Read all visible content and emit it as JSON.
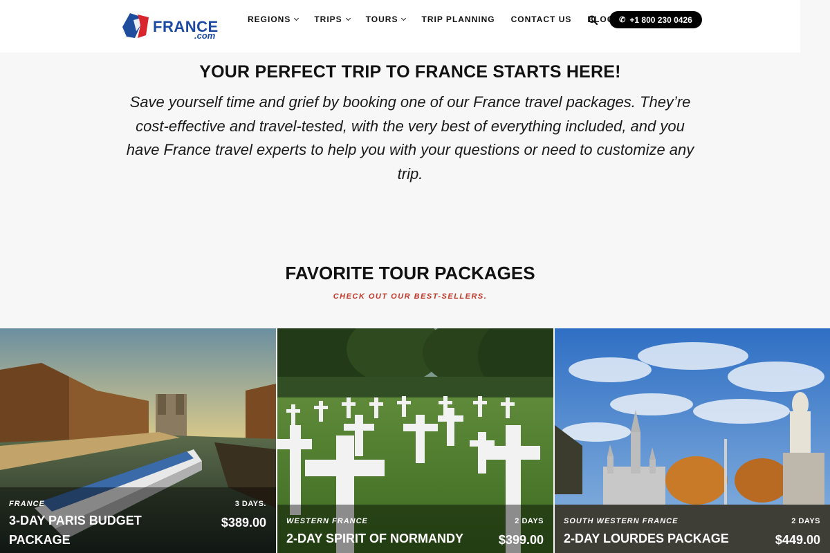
{
  "header": {
    "logo_text": "FRANCE",
    "logo_sub": ".com",
    "nav": [
      {
        "label": "REGIONS",
        "has_dropdown": true
      },
      {
        "label": "TRIPS",
        "has_dropdown": true
      },
      {
        "label": "TOURS",
        "has_dropdown": true
      },
      {
        "label": "TRIP PLANNING",
        "has_dropdown": false
      },
      {
        "label": "CONTACT US",
        "has_dropdown": false
      },
      {
        "label": "BLOG",
        "has_dropdown": false
      }
    ],
    "search_icon": "search-icon",
    "phone_label": "+1 800 230 0426"
  },
  "hero": {
    "title": "YOUR PERFECT TRIP TO FRANCE STARTS HERE!",
    "text": "Save yourself time and grief by booking one of our France travel packages. They’re cost-effective and travel-tested, with the very best of everything included, and you have France travel experts to help you with your questions or need to customize any trip."
  },
  "packages": {
    "title": "FAVORITE TOUR PACKAGES",
    "subtitle": "CHECK OUT OUR BEST-SELLERS.",
    "accent_color": "#c0392b",
    "cards": [
      {
        "region": "FRANCE",
        "days": "3 DAYS.",
        "title": "3-DAY PARIS BUDGET PACKAGE",
        "price": "$389.00",
        "image": "paris-river-cruise"
      },
      {
        "region": "WESTERN FRANCE",
        "days": "2 DAYS",
        "title": "2-DAY SPIRIT OF NORMANDY",
        "price": "$399.00",
        "image": "normandy-cemetery-crosses"
      },
      {
        "region": "SOUTH WESTERN FRANCE",
        "days": "2 DAYS",
        "title": "2-DAY LOURDES PACKAGE",
        "price": "$449.00",
        "image": "lourdes-basilica"
      }
    ]
  }
}
